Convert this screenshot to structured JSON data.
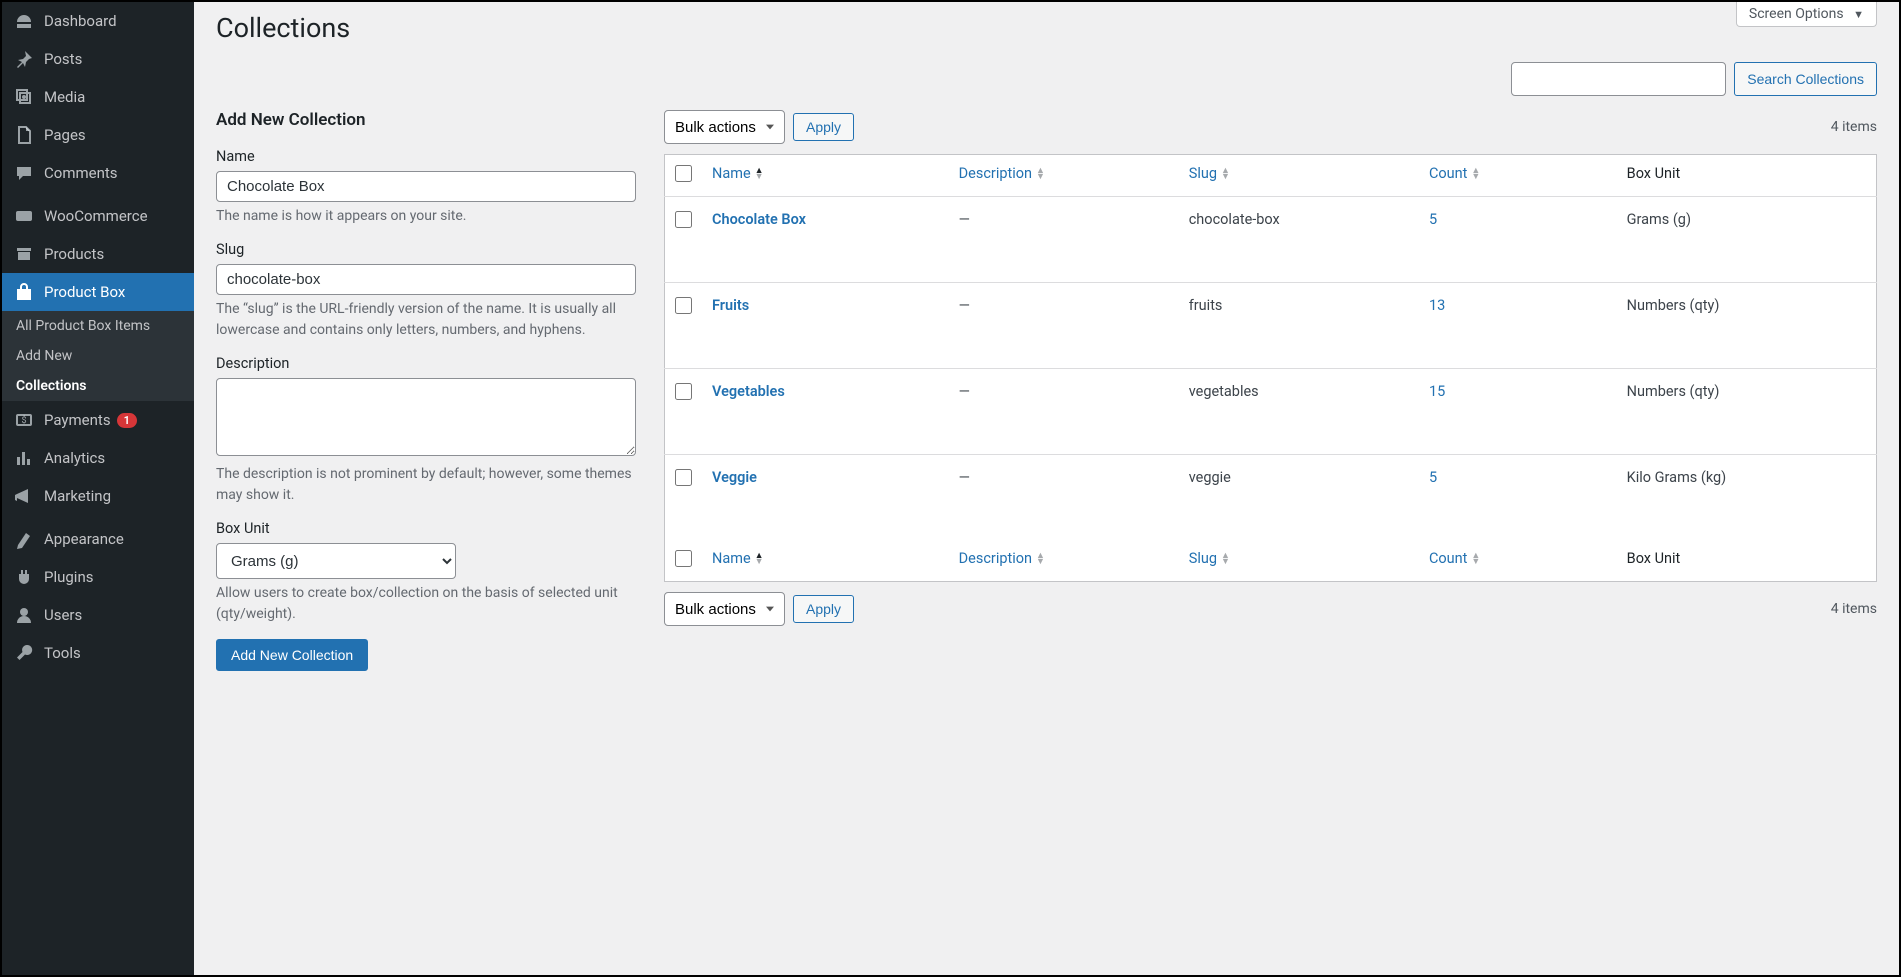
{
  "screen_options_label": "Screen Options",
  "page_title": "Collections",
  "search": {
    "button": "Search Collections",
    "value": ""
  },
  "sidebar": {
    "items": [
      {
        "label": "Dashboard",
        "icon": "dashboard"
      },
      {
        "label": "Posts",
        "icon": "pin"
      },
      {
        "label": "Media",
        "icon": "media"
      },
      {
        "label": "Pages",
        "icon": "pages"
      },
      {
        "label": "Comments",
        "icon": "comment"
      },
      {
        "label": "WooCommerce",
        "icon": "woo"
      },
      {
        "label": "Products",
        "icon": "archive"
      },
      {
        "label": "Product Box",
        "icon": "bag",
        "active": true
      },
      {
        "label": "Payments",
        "icon": "payments",
        "badge": "1"
      },
      {
        "label": "Analytics",
        "icon": "analytics"
      },
      {
        "label": "Marketing",
        "icon": "marketing"
      },
      {
        "label": "Appearance",
        "icon": "appearance"
      },
      {
        "label": "Plugins",
        "icon": "plugins"
      },
      {
        "label": "Users",
        "icon": "users"
      },
      {
        "label": "Tools",
        "icon": "tools"
      }
    ],
    "submenu": [
      {
        "label": "All Product Box Items"
      },
      {
        "label": "Add New"
      },
      {
        "label": "Collections",
        "current": true
      }
    ]
  },
  "form": {
    "title": "Add New Collection",
    "name_label": "Name",
    "name_value": "Chocolate Box",
    "name_help": "The name is how it appears on your site.",
    "slug_label": "Slug",
    "slug_value": "chocolate-box",
    "slug_help": "The “slug” is the URL-friendly version of the name. It is usually all lowercase and contains only letters, numbers, and hyphens.",
    "desc_label": "Description",
    "desc_value": "",
    "desc_help": "The description is not prominent by default; however, some themes may show it.",
    "boxunit_label": "Box Unit",
    "boxunit_value": "Grams (g)",
    "boxunit_help": "Allow users to create box/collection on the basis of selected unit (qty/weight).",
    "submit": "Add New Collection"
  },
  "table": {
    "bulk_label": "Bulk actions",
    "apply_label": "Apply",
    "items_count": "4 items",
    "columns": {
      "name": "Name",
      "description": "Description",
      "slug": "Slug",
      "count": "Count",
      "boxunit": "Box Unit"
    },
    "rows": [
      {
        "name": "Chocolate Box",
        "description": "—",
        "slug": "chocolate-box",
        "count": "5",
        "boxunit": "Grams (g)"
      },
      {
        "name": "Fruits",
        "description": "—",
        "slug": "fruits",
        "count": "13",
        "boxunit": "Numbers (qty)"
      },
      {
        "name": "Vegetables",
        "description": "—",
        "slug": "vegetables",
        "count": "15",
        "boxunit": "Numbers (qty)"
      },
      {
        "name": "Veggie",
        "description": "—",
        "slug": "veggie",
        "count": "5",
        "boxunit": "Kilo Grams (kg)"
      }
    ]
  }
}
